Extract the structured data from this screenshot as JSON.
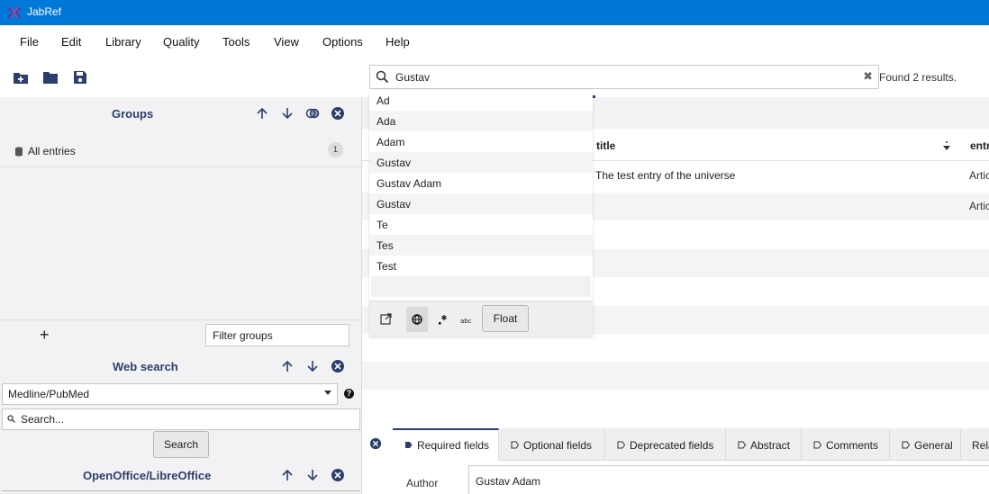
{
  "window": {
    "title": "JabRef"
  },
  "menu": [
    "File",
    "Edit",
    "Library",
    "Quality",
    "Tools",
    "View",
    "Options",
    "Help"
  ],
  "toolbar": {
    "icons": [
      "new-library-icon",
      "open-library-icon",
      "save-icon"
    ]
  },
  "search": {
    "query": "Gustav",
    "result_text": "Found 2 results."
  },
  "autocomplete": {
    "items": [
      "Ad",
      "Ada",
      "Adam",
      "Gustav",
      "Gustav Adam",
      "Gustav",
      "Te",
      "Tes",
      "Test"
    ],
    "float_label": "Float"
  },
  "groups": {
    "title": "Groups",
    "all_entries_label": "All entries",
    "all_entries_count": "1",
    "add_symbol": "+",
    "filter_placeholder": "Filter groups"
  },
  "web_search": {
    "title": "Web search",
    "selected_fetcher": "Medline/PubMed",
    "search_placeholder": "Search...",
    "search_button": "Search",
    "help_symbol": "?"
  },
  "openoffice": {
    "title": "OpenOffice/LibreOffice"
  },
  "table": {
    "columns": {
      "title": "title",
      "entry": "entr"
    },
    "rows": [
      {
        "title": "The test entry of the universe",
        "type": "Artic"
      },
      {
        "title": "",
        "type": "Artic"
      }
    ]
  },
  "editor": {
    "tabs": [
      "Required fields",
      "Optional fields",
      "Deprecated fields",
      "Abstract",
      "Comments",
      "General",
      "Rela"
    ],
    "active_tab": "Required fields",
    "author_label": "Author",
    "author_value": "Gustav Adam"
  },
  "colors": {
    "titlebar": "#0078d7",
    "header_text": "#2c3e6b",
    "pane_bg": "#f2f2f4"
  }
}
